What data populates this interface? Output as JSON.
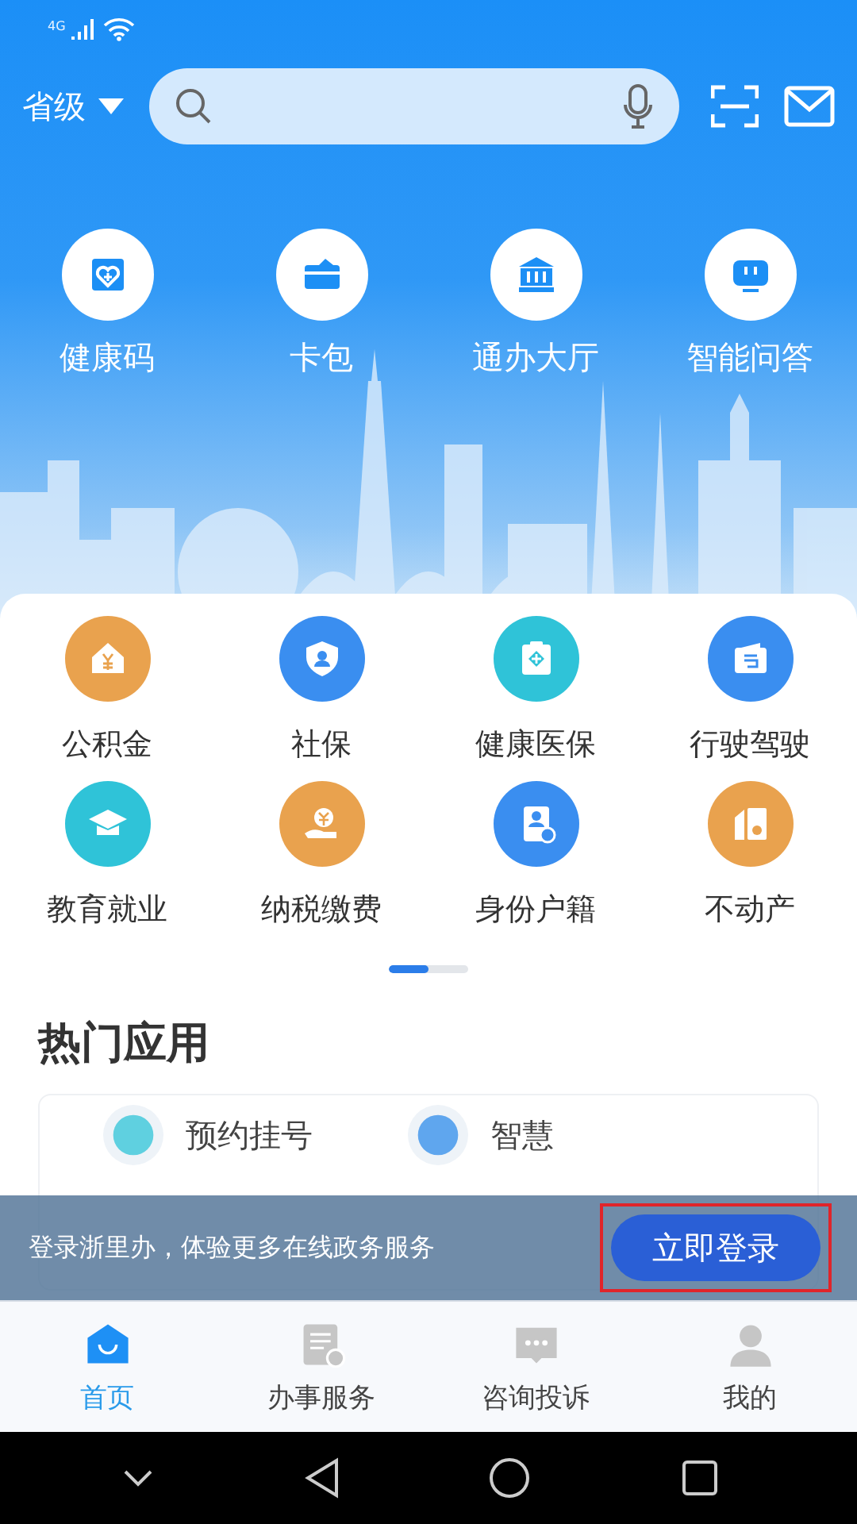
{
  "status_bar": {
    "network": "4G"
  },
  "top_bar": {
    "region": "省级"
  },
  "quick_actions": [
    {
      "label": "健康码"
    },
    {
      "label": "卡包"
    },
    {
      "label": "通办大厅"
    },
    {
      "label": "智能问答"
    }
  ],
  "services": [
    {
      "label": "公积金",
      "color": "#e9a24e"
    },
    {
      "label": "社保",
      "color": "#3a8ef0"
    },
    {
      "label": "健康医保",
      "color": "#2fc3d8"
    },
    {
      "label": "行驶驾驶",
      "color": "#3a8ef0"
    },
    {
      "label": "教育就业",
      "color": "#2fc3d8"
    },
    {
      "label": "纳税缴费",
      "color": "#e9a24e"
    },
    {
      "label": "身份户籍",
      "color": "#3a8ef0"
    },
    {
      "label": "不动产",
      "color": "#e9a24e"
    }
  ],
  "pager": {
    "level": 0.5
  },
  "hot_apps": {
    "title": "热门应用",
    "items": [
      {
        "label": "预约挂号"
      },
      {
        "label": "智慧"
      }
    ]
  },
  "login_banner": {
    "text": "登录浙里办，体验更多在线政务服务",
    "button": "立即登录"
  },
  "tabs": [
    {
      "label": "首页",
      "selected": true
    },
    {
      "label": "办事服务",
      "selected": false
    },
    {
      "label": "咨询投诉",
      "selected": false
    },
    {
      "label": "我的",
      "selected": false
    }
  ]
}
